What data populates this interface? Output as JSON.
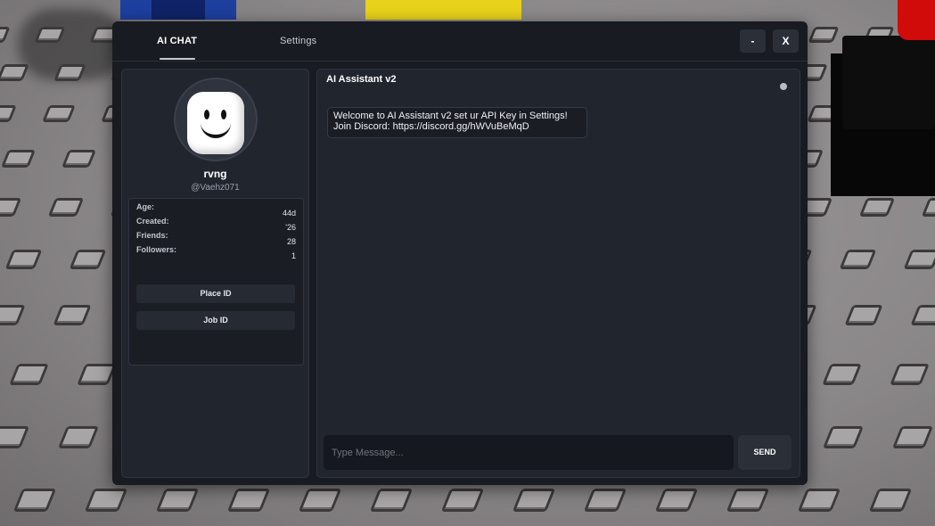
{
  "tabs": {
    "chat": "AI CHAT",
    "settings": "Settings"
  },
  "window_buttons": {
    "minimize": "-",
    "close": "X"
  },
  "profile": {
    "username": "rvng",
    "handle": "@Vaehz071",
    "stats": [
      {
        "label": "Age:",
        "value": "44d"
      },
      {
        "label": "Created:",
        "value": "'26"
      },
      {
        "label": "Friends:",
        "value": "28"
      },
      {
        "label": "Followers:",
        "value": "1"
      }
    ],
    "buttons": {
      "place_id": "Place ID",
      "job_id": "Job ID"
    }
  },
  "chat": {
    "title": "AI Assistant v2",
    "messages": [
      {
        "line1": "Welcome to AI Assistant v2 set ur API Key in Settings!",
        "line2": "Join Discord: https://discord.gg/hWVuBeMqD"
      }
    ],
    "input_placeholder": "Type Message...",
    "send_label": "SEND"
  },
  "colors": {
    "window_bg": "#181b21",
    "panel_bg": "#21252e",
    "button_bg": "#2b2f37",
    "text": "#ffffff"
  },
  "icons": {
    "avatar": "smiley-avatar-icon",
    "status": "status-dot-icon"
  }
}
